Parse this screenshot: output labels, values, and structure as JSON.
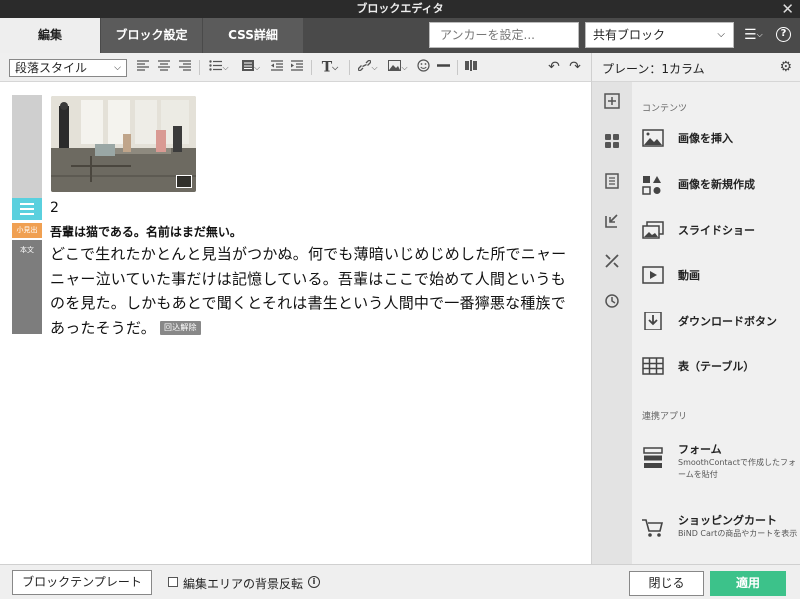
{
  "window": {
    "title": "ブロックエディタ",
    "close_glyph": "✕"
  },
  "tabs": [
    {
      "label": "編集",
      "active": true
    },
    {
      "label": "ブロック設定",
      "active": false
    },
    {
      "label": "CSS詳細",
      "active": false
    }
  ],
  "anchor": {
    "placeholder": "アンカーを設定..."
  },
  "shared_block": {
    "selected": "共有ブロック"
  },
  "toolbar": {
    "paragraph_style": "段落スタイル",
    "icons": [
      "align-left-icon",
      "align-center-icon",
      "align-right-icon",
      "bullet-list-icon",
      "block-format-icon",
      "outdent-icon",
      "indent-icon",
      "text-style-icon",
      "link-icon",
      "image-icon",
      "emoji-icon",
      "horizontal-rule-icon",
      "column-icon",
      "undo-icon",
      "redo-icon"
    ]
  },
  "editor": {
    "image_caption": "2",
    "heading": "吾輩は猫である。名前はまだ無い。",
    "body": "どこで生れたかとんと見当がつかぬ。何でも薄暗いじめじめした所でニャーニャー泣いていた事だけは記憶している。吾輩はここで始めて人間というものを見た。しかもあとで聞くとそれは書生という人間中で一番獰悪な種族であったそうだ。",
    "release_label": "回込解除",
    "rail_labels": {
      "heading": "小見出",
      "body": "本文"
    }
  },
  "right_panel": {
    "title": "プレーン：1カラム",
    "contents_label": "コンテンツ",
    "items": [
      {
        "label": "画像を挿入",
        "icon": "image-icon"
      },
      {
        "label": "画像を新規作成",
        "icon": "shapes-icon"
      },
      {
        "label": "スライドショー",
        "icon": "slideshow-icon"
      },
      {
        "label": "動画",
        "icon": "video-icon"
      },
      {
        "label": "ダウンロードボタン",
        "icon": "download-icon"
      },
      {
        "label": "表（テーブル）",
        "icon": "table-icon"
      }
    ],
    "apps_label": "連携アプリ",
    "apps": [
      {
        "label": "フォーム",
        "desc": "SmoothContactで作成したフォームを貼付",
        "icon": "form-icon"
      },
      {
        "label": "ショッピングカート",
        "desc": "BiND Cartの商品やカートを表示",
        "icon": "cart-icon"
      }
    ]
  },
  "footer": {
    "template_button": "ブロックテンプレート",
    "invert_label": "編集エリアの背景反転",
    "close_button": "閉じる",
    "apply_button": "適用"
  },
  "colors": {
    "accent_green": "#3cc28a",
    "rail_blue": "#5ad0de",
    "rail_orange": "#f0a052"
  }
}
